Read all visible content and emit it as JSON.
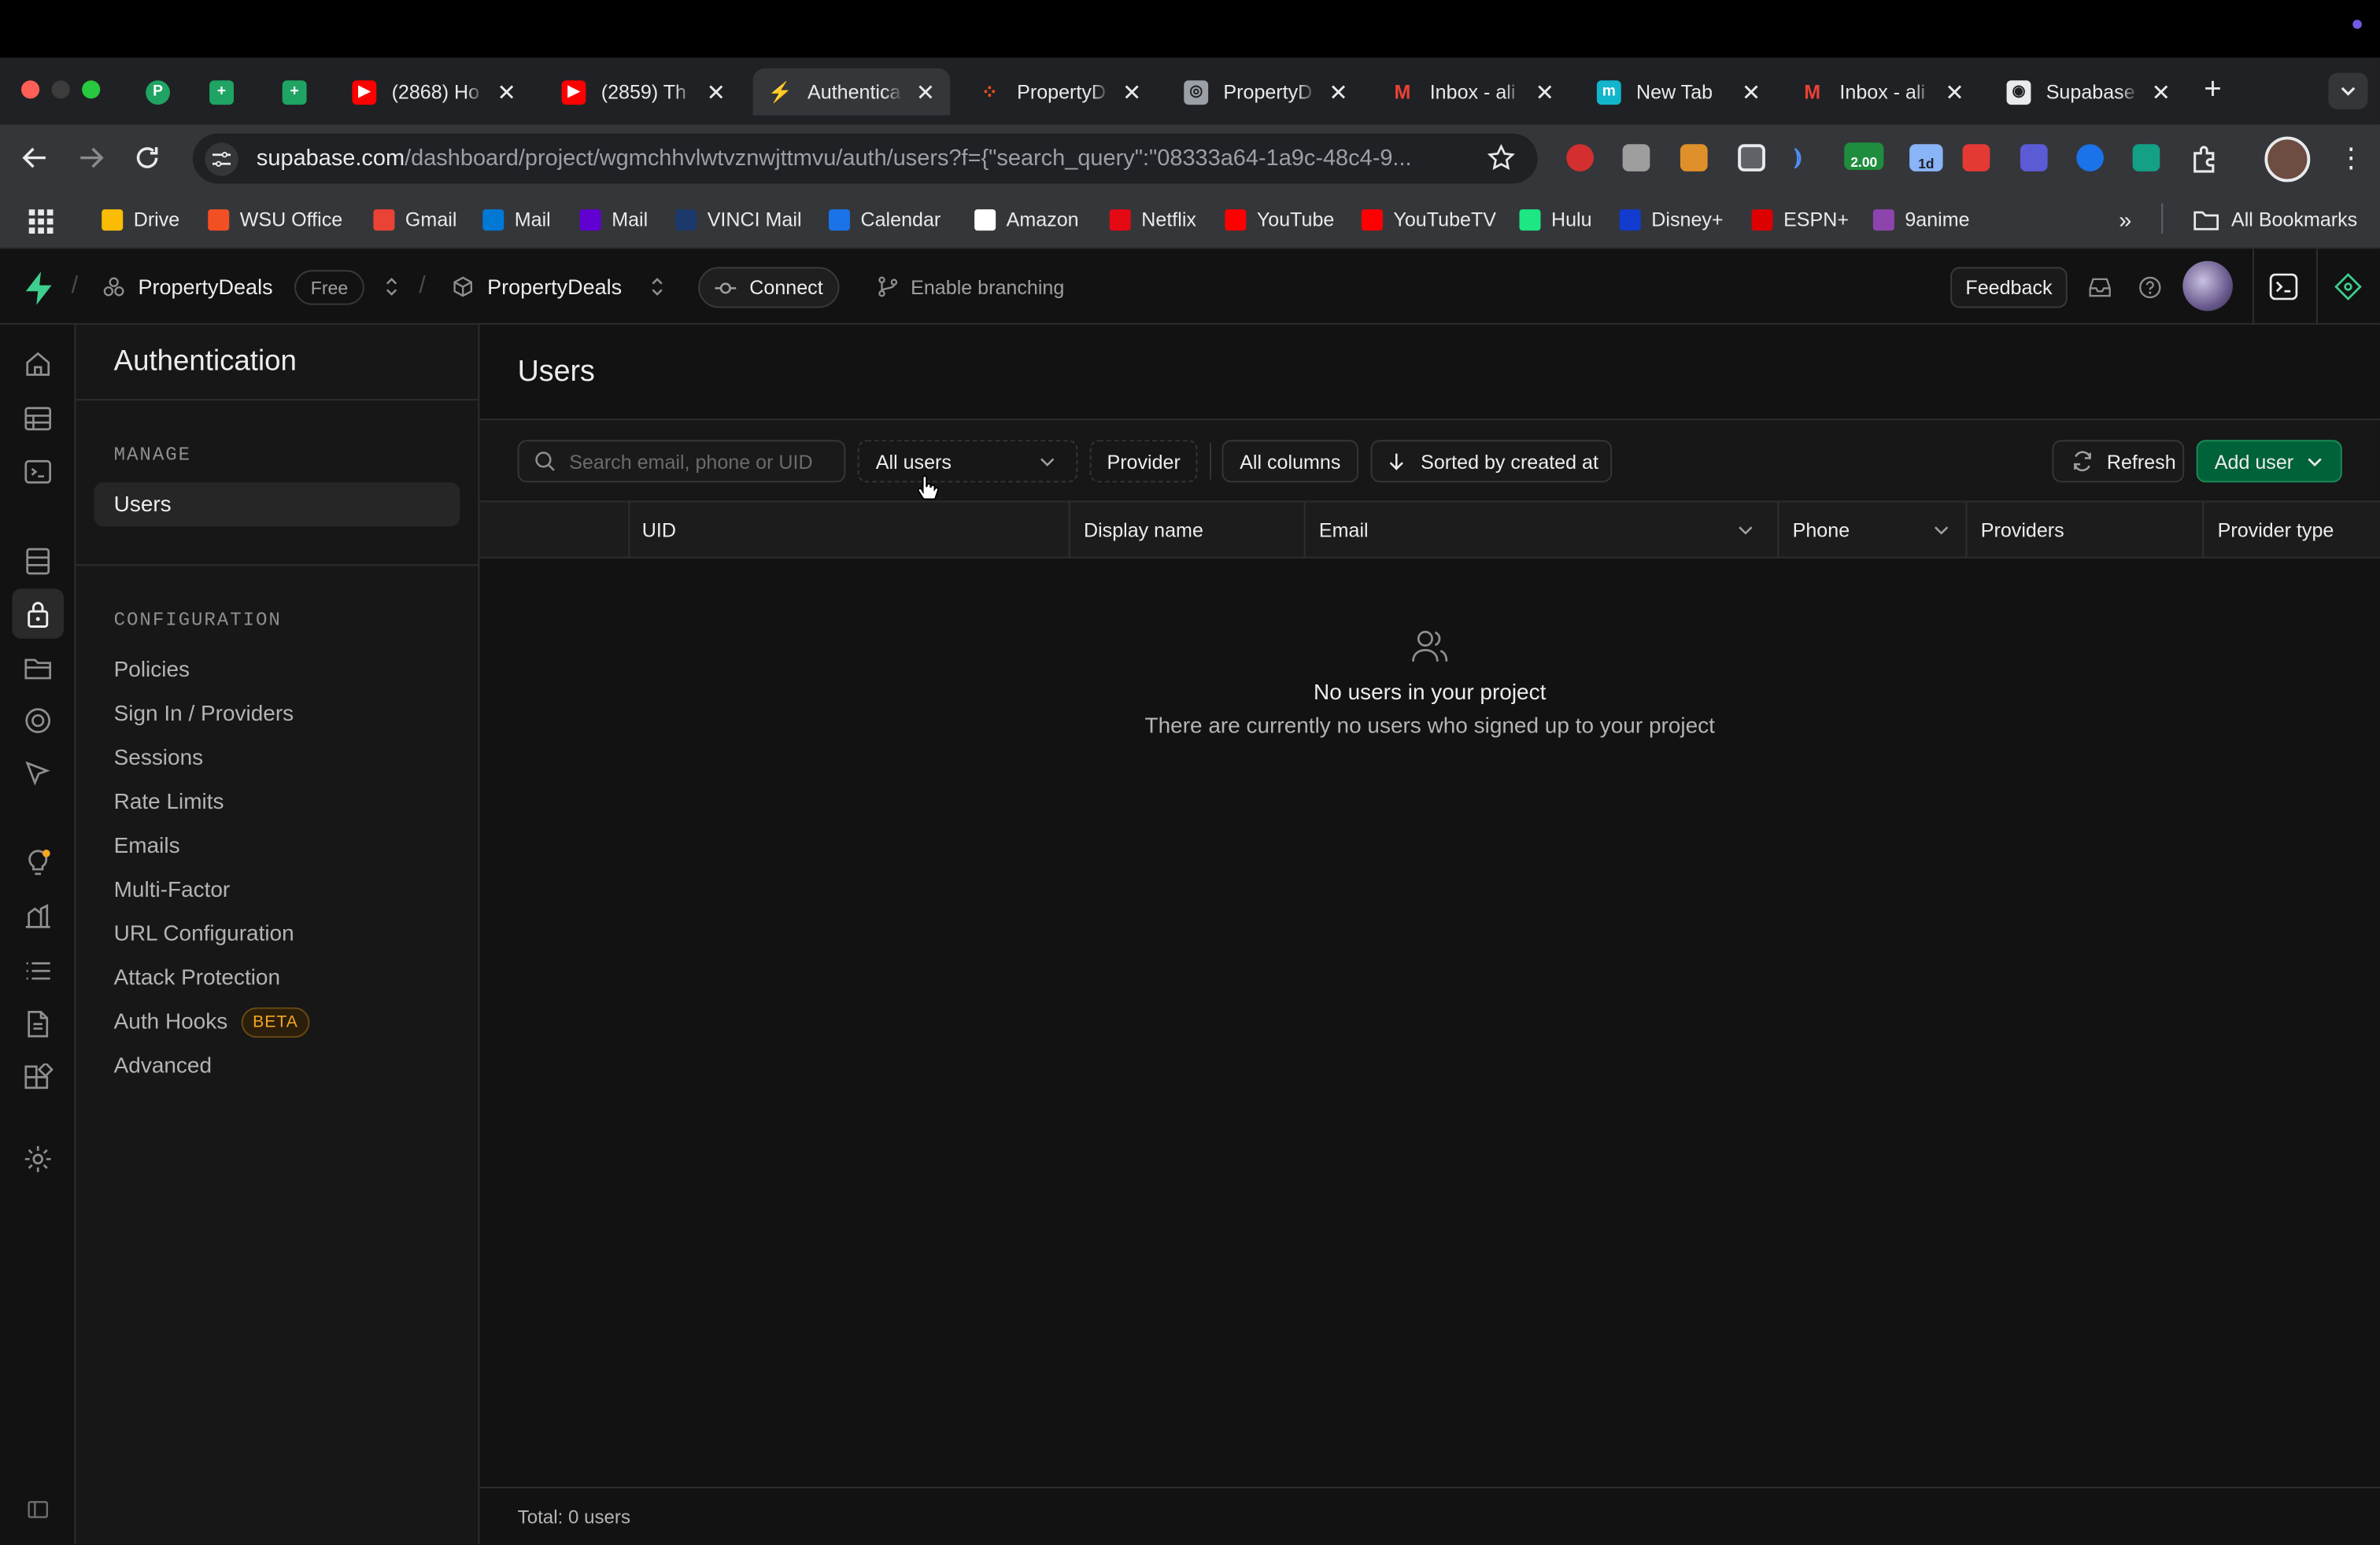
{
  "browser": {
    "tabs": [
      {
        "title": "",
        "fav_color": "#1fa463",
        "fav_letter": "P"
      },
      {
        "title": "",
        "fav_color": "#1fa463",
        "fav_letter": "+"
      },
      {
        "title": "",
        "fav_color": "#1fa463",
        "fav_letter": "+"
      },
      {
        "title": "(2868) Ho",
        "fav_color": "#ff0000",
        "fav_letter": "▶"
      },
      {
        "title": "(2859) Th",
        "fav_color": "#ff0000",
        "fav_letter": "▶"
      },
      {
        "title": "Authentica",
        "fav_color": "#3ecf8e",
        "fav_letter": "⚡"
      },
      {
        "title": "PropertyD",
        "fav_color": "#f24e1e",
        "fav_letter": "⁘"
      },
      {
        "title": "PropertyD",
        "fav_color": "#9aa0a6",
        "fav_letter": "◎"
      },
      {
        "title": "Inbox - ali",
        "fav_color": "#ea4335",
        "fav_letter": "M"
      },
      {
        "title": "New Tab",
        "fav_color": "#12b5cb",
        "fav_letter": "m"
      },
      {
        "title": "Inbox - ali",
        "fav_color": "#ea4335",
        "fav_letter": "M"
      },
      {
        "title": "Supabase",
        "fav_color": "#e8eaed",
        "fav_letter": "◉"
      }
    ],
    "url_domain": "supabase.com",
    "url_path": "/dashboard/project/wgmchhvlwtvznwjttmvu/auth/users?f={\"search_query\":\"08333a64-1a9c-48c4-9...",
    "bookmarks": [
      {
        "label": "Drive",
        "color": "#fbbc04"
      },
      {
        "label": "WSU Office",
        "color": "#f25022"
      },
      {
        "label": "Gmail",
        "color": "#ea4335"
      },
      {
        "label": "Mail",
        "color": "#0078d4"
      },
      {
        "label": "Mail",
        "color": "#6001d2"
      },
      {
        "label": "VINCI Mail",
        "color": "#1b3a6b"
      },
      {
        "label": "Calendar",
        "color": "#1a73e8"
      },
      {
        "label": "Amazon",
        "color": "#ffffff"
      },
      {
        "label": "Netflix",
        "color": "#e50914"
      },
      {
        "label": "YouTube",
        "color": "#ff0000"
      },
      {
        "label": "YouTubeTV",
        "color": "#ff0000"
      },
      {
        "label": "Hulu",
        "color": "#1ce783"
      },
      {
        "label": "Disney+",
        "color": "#113ccf"
      },
      {
        "label": "ESPN+",
        "color": "#d00"
      },
      {
        "label": "9anime",
        "color": "#8e44ad"
      }
    ],
    "all_bookmarks": "All Bookmarks",
    "ext_badge_1": "2.00",
    "ext_badge_2": "1d"
  },
  "app": {
    "org": "PropertyDeals",
    "plan": "Free",
    "project": "PropertyDeals",
    "connect": "Connect",
    "branching": "Enable branching",
    "feedback": "Feedback"
  },
  "sidebar": {
    "title": "Authentication",
    "manage_heading": "MANAGE",
    "manage_items": [
      "Users"
    ],
    "config_heading": "CONFIGURATION",
    "config_items": [
      "Policies",
      "Sign In / Providers",
      "Sessions",
      "Rate Limits",
      "Emails",
      "Multi-Factor",
      "URL Configuration",
      "Attack Protection",
      "Auth Hooks",
      "Advanced"
    ],
    "beta_badge": "BETA"
  },
  "main": {
    "title": "Users",
    "search_placeholder": "Search email, phone or UID",
    "filter_users": "All users",
    "filter_provider": "Provider",
    "columns_button": "All columns",
    "sort_button": "Sorted by created at",
    "refresh": "Refresh",
    "add_user": "Add user",
    "columns": [
      "UID",
      "Display name",
      "Email",
      "Phone",
      "Providers",
      "Provider type"
    ],
    "empty_title": "No users in your project",
    "empty_desc": "There are currently no users who signed up to your project",
    "total": "Total: 0 users"
  },
  "colors": {
    "accent": "#3ecf8e",
    "add_user_bg": "#006239",
    "beta": "#f5a623"
  }
}
